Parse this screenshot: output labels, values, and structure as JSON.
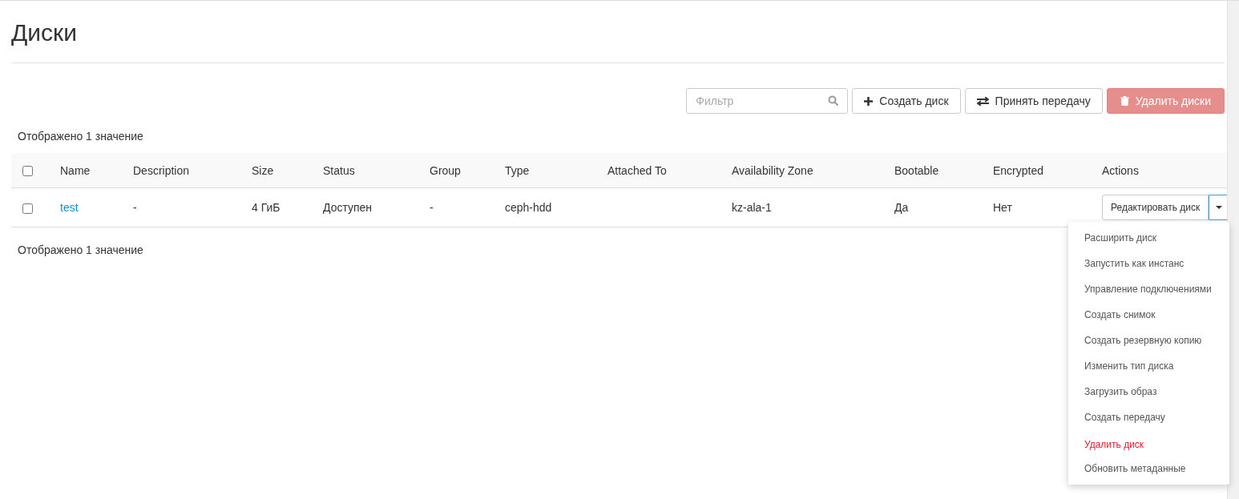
{
  "page": {
    "title": "Диски"
  },
  "toolbar": {
    "filter": {
      "placeholder": "Фильтр"
    },
    "buttons": [
      {
        "kind": "create",
        "label": "Создать диск",
        "disabled": false
      },
      {
        "kind": "accept",
        "label": "Принять передачу",
        "disabled": false
      },
      {
        "kind": "delete",
        "label": "Удалить диски",
        "disabled": true
      }
    ]
  },
  "summary_top": "Отображено 1 значение",
  "table": {
    "select_all": {
      "checked": false
    },
    "columns": [
      "Name",
      "Description",
      "Size",
      "Status",
      "Group",
      "Type",
      "Attached To",
      "Availability Zone",
      "Bootable",
      "Encrypted",
      "Actions"
    ],
    "rows": [
      {
        "checked": false,
        "name": "test",
        "description": "-",
        "size": "4 ГиБ",
        "status": "Доступен",
        "group": "-",
        "type": "ceph-hdd",
        "attached_to": "",
        "availability_zone": "kz-ala-1",
        "bootable": "Да",
        "encrypted": "Нет",
        "action": "Редактировать диск",
        "menu_expanded": true
      }
    ]
  },
  "summary_bottom": "Отображено 1 значение",
  "action_menu": [
    {
      "kind": "normal",
      "label": "Расширить диск"
    },
    {
      "kind": "normal",
      "label": "Запустить как инстанс"
    },
    {
      "kind": "normal",
      "label": "Управление подключениями"
    },
    {
      "kind": "normal",
      "label": "Создать снимок"
    },
    {
      "kind": "normal",
      "label": "Создать резервную копию"
    },
    {
      "kind": "normal",
      "label": "Изменить тип диска"
    },
    {
      "kind": "normal",
      "label": "Загрузить образ"
    },
    {
      "kind": "normal",
      "label": "Создать передачу"
    },
    {
      "kind": "danger",
      "label": "Удалить диск"
    },
    {
      "kind": "normal",
      "label": "Обновить метаданные"
    }
  ]
}
